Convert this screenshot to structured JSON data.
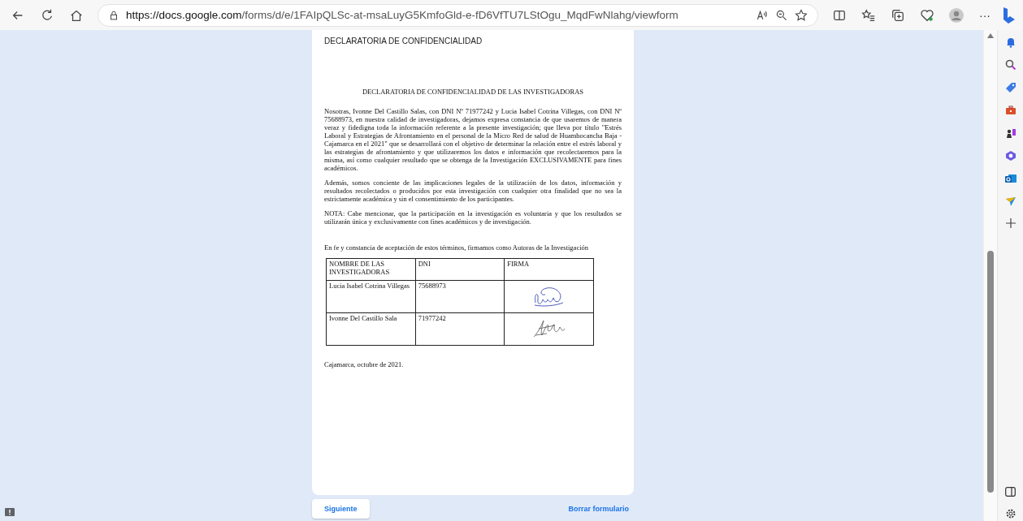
{
  "browser": {
    "url_host": "https://docs.google.com",
    "url_path": "/forms/d/e/1FAIpQLSc-at-msaLuyG5KmfoGld-e-fD6VfTU7LStOgu_MqdFwNlahg/viewform",
    "more": "···"
  },
  "form": {
    "question_title": "DECLARATORIA DE CONFIDENCIALIDAD",
    "document": {
      "title": "DECLARATORIA DE CONFIDENCIALIDAD DE LAS INVESTIGADORAS",
      "paragraphs": [
        "Nosotras, Ivonne Del Castillo Salas, con DNI Nº 71977242 y Lucia Isabel Cotrina Villegas, con DNI Nº 75688973, en nuestra calidad de investigadoras, dejamos expresa constancia de que usaremos de manera veraz y fidedigna toda la información referente a la presente investigación; que lleva por título \"Estrés Laboral y Estrategias de Afrontamiento en el personal de la Micro Red de salud de Huambocancha Baja - Cajamarca en el 2021\" que se desarrollará con el objetivo de determinar la relación entre el estrés laboral y las estrategias de afrontamiento y que utilizaremos los datos e información que recolectaremos para la misma, así como cualquier resultado que se obtenga de la Investigación EXCLUSIVAMENTE para fines académicos.",
        "Además, somos conciente de las implicaciones legales de la utilización de los datos, información y resultados recolectados o producidos por esta investigación con cualquier otra finalidad que no sea la estrictamente académica y sin el consentimiento de los participantes.",
        "NOTA: Cabe mencionar, que la participación en la investigación es voluntaria y que los resultados se utilizarán única y exclusivamente con fines académicos y de investigación."
      ],
      "acceptance": "En fe y constancia de aceptación de estos términos, firmamos como Autoras de la Investigación",
      "table": {
        "columns": [
          "NOMBRE DE LAS INVESTIGADORAS",
          "DNI",
          "FIRMA"
        ],
        "rows": [
          {
            "name": "Lucia Isabel Cotrina Villegas",
            "dni": "75688973"
          },
          {
            "name": "Ivonne Del Castillo Sala",
            "dni": "71977242"
          }
        ]
      },
      "closing": "Cajamarca, octubre de 2021."
    }
  },
  "buttons": {
    "next": "Siguiente",
    "clear": "Borrar formulario"
  }
}
